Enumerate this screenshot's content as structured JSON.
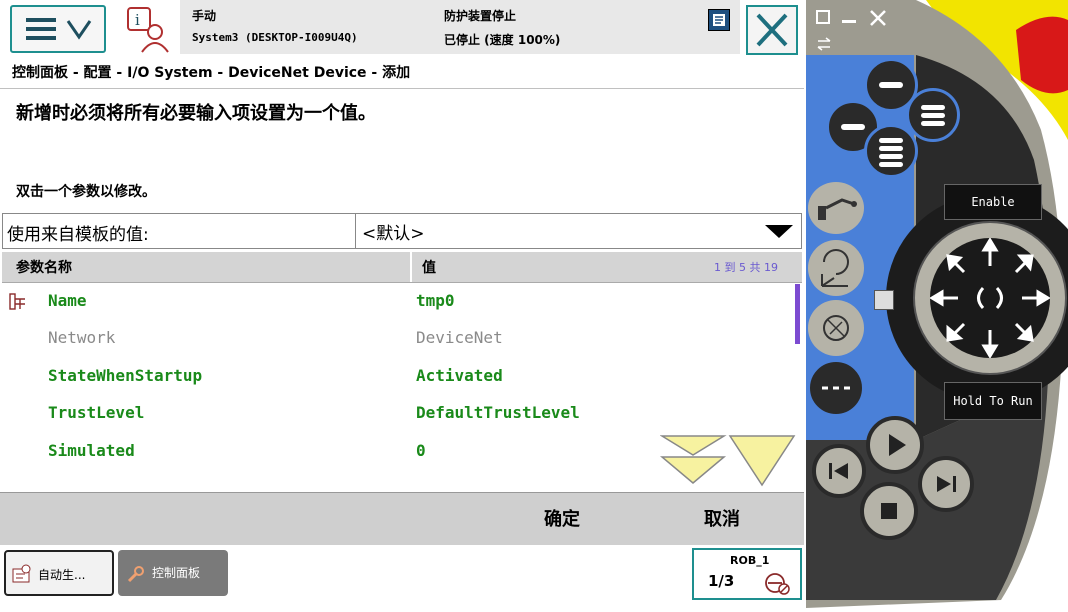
{
  "status": {
    "mode": "手动",
    "system": "System3 (DESKTOP-I009U4Q)",
    "safety": "防护装置停止",
    "state": "已停止 (速度 100%)"
  },
  "breadcrumb": "控制面板 - 配置 - I/O System - DeviceNet Device - 添加",
  "messages": {
    "required": "新增时必须将所有必要输入项设置为一个值。",
    "hint": "双击一个参数以修改。"
  },
  "template": {
    "label": "使用来自模板的值:",
    "value": "<默认>"
  },
  "table": {
    "col_name": "参数名称",
    "col_value": "值",
    "paging": "1 到 5 共 19",
    "rows": [
      {
        "name": "Name",
        "value": "tmp0"
      },
      {
        "name": "Network",
        "value": "DeviceNet"
      },
      {
        "name": "StateWhenStartup",
        "value": "Activated"
      },
      {
        "name": "TrustLevel",
        "value": "DefaultTrustLevel"
      },
      {
        "name": "Simulated",
        "value": "0"
      }
    ]
  },
  "actions": {
    "ok": "确定",
    "cancel": "取消"
  },
  "taskbar": {
    "task1": "自动生...",
    "task2": "控制面板",
    "robot": "ROB_1",
    "increment": "1/3"
  },
  "pendant": {
    "enable": "Enable",
    "hold_to_run": "Hold To Run"
  },
  "colors": {
    "accent": "#1e8f8f",
    "value_green": "#1a8a1a",
    "scroll_purple": "#7c4bd1",
    "pendant_blue": "#4a80d8",
    "pendant_dark": "#2a2a2a",
    "pendant_yellow": "#f2e400",
    "estop_red": "#d81818"
  }
}
